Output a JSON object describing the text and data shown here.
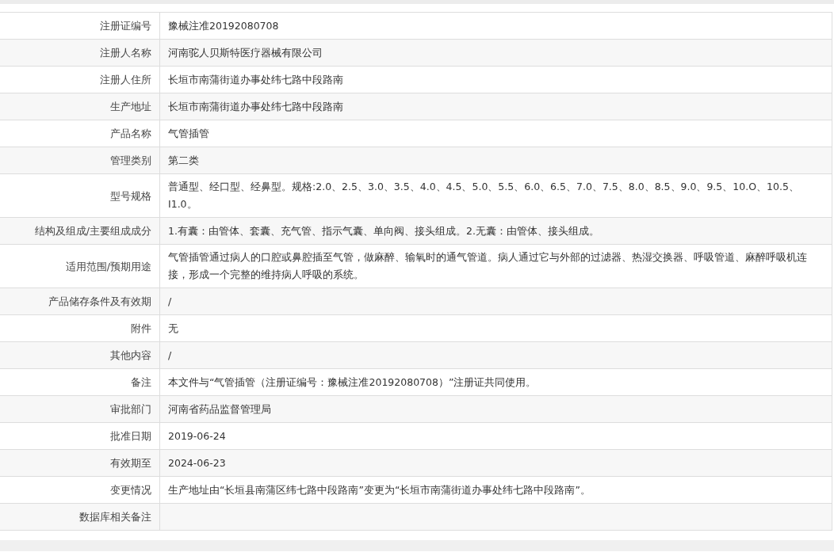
{
  "rows": [
    {
      "label": "注册证编号",
      "value": "豫械注准20192080708"
    },
    {
      "label": "注册人名称",
      "value": "河南驼人贝斯特医疗器械有限公司"
    },
    {
      "label": "注册人住所",
      "value": "长垣市南蒲街道办事处纬七路中段路南"
    },
    {
      "label": "生产地址",
      "value": "长垣市南蒲街道办事处纬七路中段路南"
    },
    {
      "label": "产品名称",
      "value": "气管插管"
    },
    {
      "label": "管理类别",
      "value": "第二类"
    },
    {
      "label": "型号规格",
      "value": "普通型、经口型、经鼻型。规格:2.0、2.5、3.0、3.5、4.0、4.5、5.0、5.5、6.0、6.5、7.0、7.5、8.0、8.5、9.0、9.5、10.O、10.5、I1.0。"
    },
    {
      "label": "结构及组成/主要组成成分",
      "value": "1.有囊：由管体、套囊、充气管、指示气囊、单向阀、接头组成。2.无囊：由管体、接头组成。"
    },
    {
      "label": "适用范围/预期用途",
      "value": "气管插管通过病人的口腔或鼻腔插至气管，做麻醉、输氧时的通气管道。病人通过它与外部的过滤器、热湿交换器、呼吸管道、麻醉呼吸机连接，形成一个完整的维持病人呼吸的系统。"
    },
    {
      "label": "产品储存条件及有效期",
      "value": "/"
    },
    {
      "label": "附件",
      "value": "无"
    },
    {
      "label": "其他内容",
      "value": "/"
    },
    {
      "label": "备注",
      "value": "本文件与“气管插管（注册证编号：豫械注准20192080708）”注册证共同使用。"
    },
    {
      "label": "审批部门",
      "value": "河南省药品监督管理局"
    },
    {
      "label": "批准日期",
      "value": "2019-06-24"
    },
    {
      "label": "有效期至",
      "value": "2024-06-23"
    },
    {
      "label": "变更情况",
      "value": "生产地址由“长垣县南蒲区纬七路中段路南”变更为“长垣市南蒲街道办事处纬七路中段路南”。"
    },
    {
      "label": "数据库相关备注"
    }
  ]
}
